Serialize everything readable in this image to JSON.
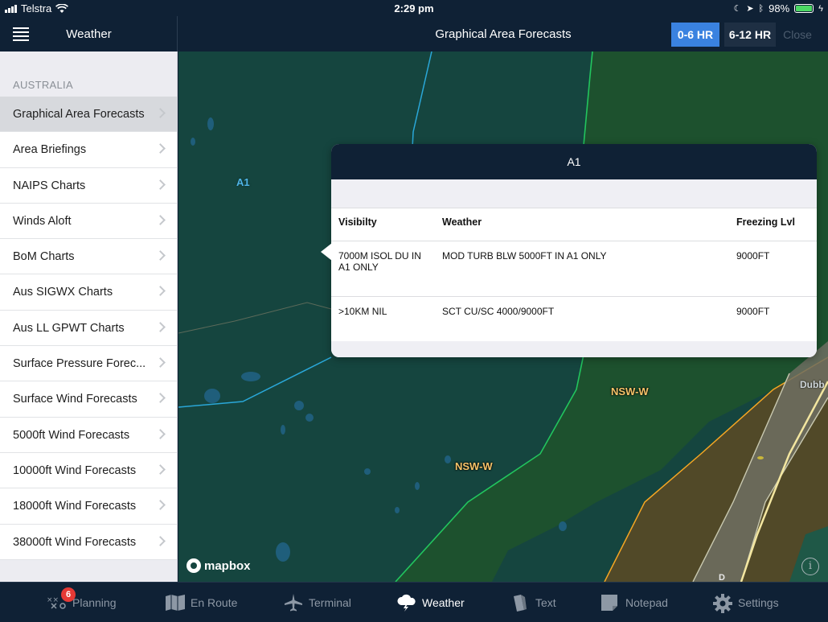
{
  "status_bar": {
    "carrier": "Telstra",
    "time": "2:29 pm",
    "battery": "98%"
  },
  "sidebar": {
    "title": "Weather",
    "section": "AUSTRALIA",
    "items": [
      {
        "label": "Graphical Area Forecasts",
        "selected": true
      },
      {
        "label": "Area Briefings"
      },
      {
        "label": "NAIPS Charts"
      },
      {
        "label": "Winds Aloft"
      },
      {
        "label": "BoM Charts"
      },
      {
        "label": "Aus SIGWX Charts"
      },
      {
        "label": "Aus LL GPWT Charts"
      },
      {
        "label": "Surface Pressure Forec..."
      },
      {
        "label": "Surface Wind Forecasts"
      },
      {
        "label": "5000ft Wind Forecasts"
      },
      {
        "label": "10000ft Wind Forecasts"
      },
      {
        "label": "18000ft Wind Forecasts"
      },
      {
        "label": "38000ft Wind Forecasts"
      }
    ]
  },
  "header": {
    "title": "Graphical Area Forecasts",
    "seg_0_6": "0-6 HR",
    "seg_6_12": "6-12 HR",
    "close": "Close"
  },
  "map": {
    "labels": {
      "a1": "A1",
      "nsw_w_1": "NSW-W",
      "nsw_w_2": "NSW-W",
      "dubbo": "Dubb",
      "d": "D"
    },
    "attribution": "mapbox",
    "info": "i"
  },
  "popover": {
    "title": "A1",
    "columns": [
      "Visibilty",
      "Weather",
      "Freezing Lvl"
    ],
    "rows": [
      {
        "visibility": "7000M ISOL DU IN A1 ONLY",
        "weather": "MOD TURB BLW 5000FT IN A1 ONLY",
        "freezing": "9000FT"
      },
      {
        "visibility": ">10KM NIL",
        "weather": "SCT CU/SC 4000/9000FT",
        "freezing": "9000FT"
      }
    ]
  },
  "tabbar": {
    "badge": "6",
    "tabs": [
      {
        "label": "Planning",
        "icon": "planning-icon"
      },
      {
        "label": "En Route",
        "icon": "map-icon"
      },
      {
        "label": "Terminal",
        "icon": "airplane-icon"
      },
      {
        "label": "Weather",
        "icon": "cloud-lightning-icon",
        "active": true
      },
      {
        "label": "Text",
        "icon": "document-icon"
      },
      {
        "label": "Notepad",
        "icon": "notepad-icon"
      },
      {
        "label": "Settings",
        "icon": "gear-icon"
      }
    ]
  },
  "colors": {
    "nav_bg": "#0f2135",
    "accent": "#3a82e0",
    "map_teal": "#15453f",
    "map_green": "#1f5a2c",
    "label_orange": "#f7c469"
  }
}
